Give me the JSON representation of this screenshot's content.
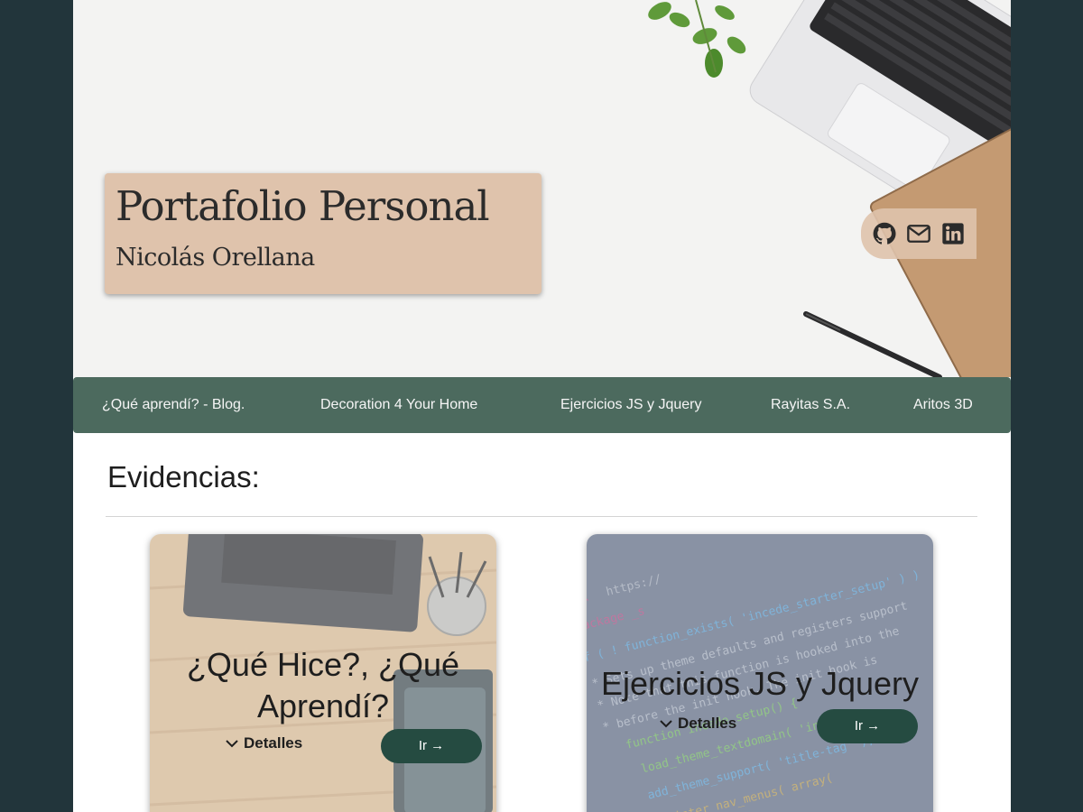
{
  "header": {
    "title": "Portafolio Personal",
    "subtitle": "Nicolás Orellana",
    "social_icons": [
      "github-icon",
      "mail-icon",
      "linkedin-icon"
    ]
  },
  "nav": {
    "items": [
      {
        "label": "¿Qué aprendí? - Blog."
      },
      {
        "label": "Decoration 4 Your Home"
      },
      {
        "label": "Ejercicios JS y Jquery"
      },
      {
        "label": "Rayitas S.A."
      },
      {
        "label": "Aritos 3D"
      }
    ]
  },
  "section": {
    "heading": "Evidencias:"
  },
  "cards": [
    {
      "title_line1": "¿Qué Hice?, ¿Qué",
      "title_line2": "Aprendí?",
      "details_label": "Detalles",
      "button_label": "Ir →"
    },
    {
      "title": "Ejercicios JS y Jquery",
      "details_label": "Detalles",
      "button_label": "Ir →"
    }
  ],
  "colors": {
    "page_background": "#22353b",
    "nav_background": "#4c6a5e",
    "title_card": "#dfc3ac",
    "button": "#254b41"
  }
}
